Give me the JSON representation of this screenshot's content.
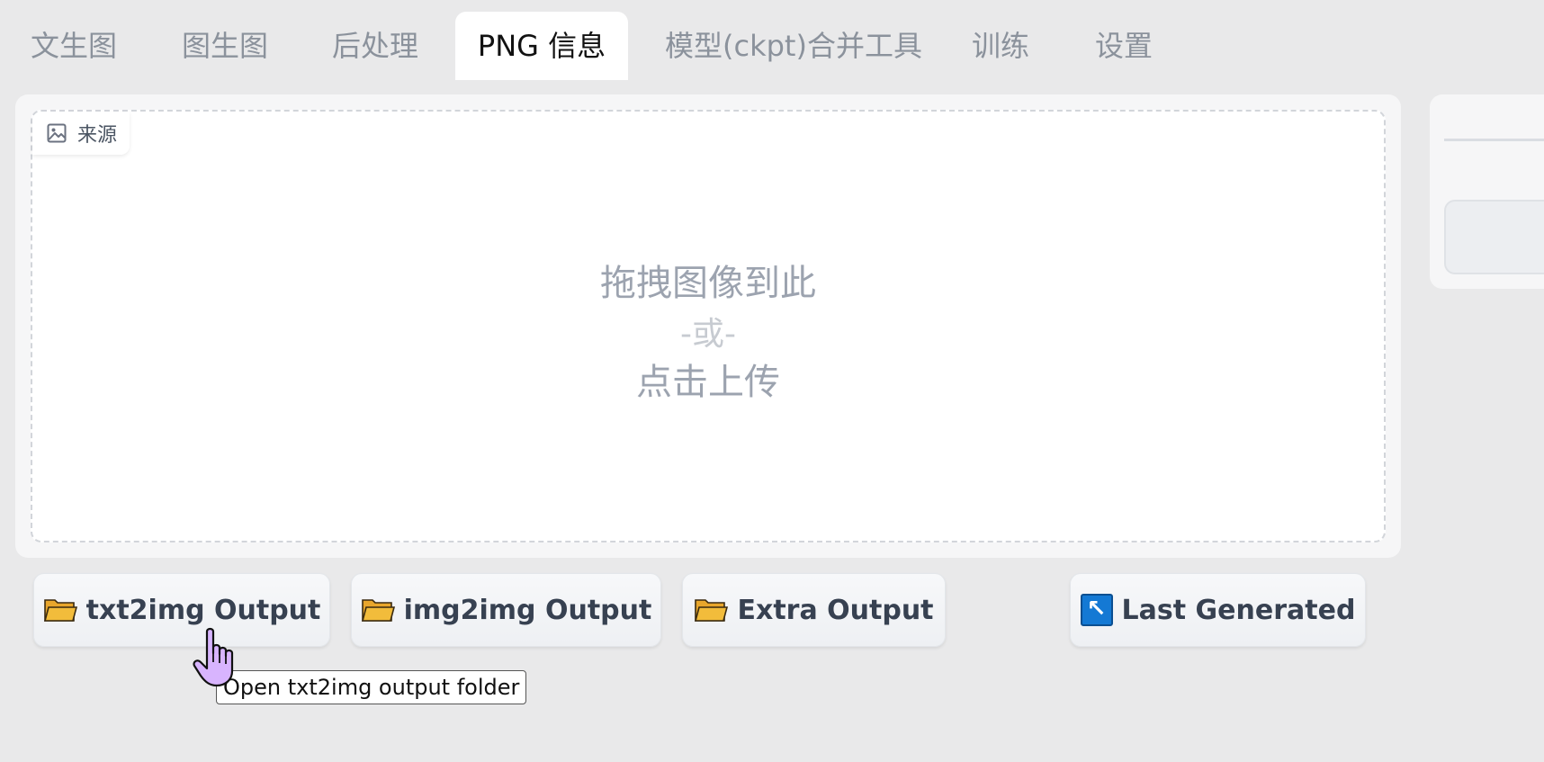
{
  "tabs": [
    {
      "label": "文生图",
      "active": false
    },
    {
      "label": "图生图",
      "active": false
    },
    {
      "label": "后处理",
      "active": false
    },
    {
      "label": "PNG 信息",
      "active": true
    },
    {
      "label": "模型(ckpt)合并工具",
      "active": false
    },
    {
      "label": "训练",
      "active": false
    },
    {
      "label": "设置",
      "active": false
    }
  ],
  "source": {
    "label": "来源",
    "icon": "image-icon",
    "drop_text": "拖拽图像到此",
    "or_text": "-或-",
    "click_text": "点击上传"
  },
  "buttons": [
    {
      "label": "txt2img Output",
      "icon": "folder-icon"
    },
    {
      "label": "img2img Output",
      "icon": "folder-icon"
    },
    {
      "label": "Extra Output",
      "icon": "folder-icon"
    },
    {
      "label": "Last Generated",
      "icon": "arrow-up-left-icon",
      "glyph": "↖"
    }
  ],
  "tooltip": {
    "text": "Open txt2img output folder"
  },
  "colors": {
    "background": "#e9e9ea",
    "active_tab": "#ffffff",
    "inactive_tab_text": "#8b929c",
    "arrow_icon_bg": "#1479d4",
    "folder_fill": "#f2bc3b",
    "cursor_fill": "#d8b4fe"
  }
}
